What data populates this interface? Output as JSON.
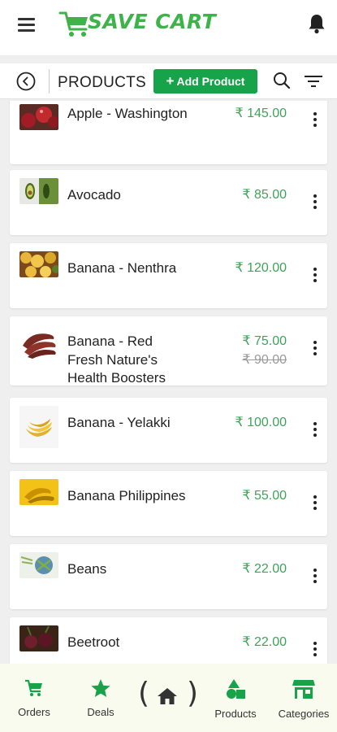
{
  "header": {
    "logo_text": "SAVE CART",
    "brand_color": "#3db34a"
  },
  "subbar": {
    "title": "PRODUCTS",
    "add_button_label": "Add Product",
    "accent_color": "#16a34a"
  },
  "products": [
    {
      "name": "Apple - Washington",
      "price": "₹ 145.00",
      "old_price": null,
      "thumb": "apple"
    },
    {
      "name": "Avocado",
      "price": "₹ 85.00",
      "old_price": null,
      "thumb": "avocado"
    },
    {
      "name": "Banana - Nenthra",
      "price": "₹ 120.00",
      "old_price": null,
      "thumb": "banana-chips"
    },
    {
      "name": "Banana - Red Fresh Nature's Health Boosters",
      "price": "₹ 75.00",
      "old_price": "₹ 90.00",
      "thumb": "red-banana"
    },
    {
      "name": "Banana - Yelakki",
      "price": "₹ 100.00",
      "old_price": null,
      "thumb": "yelakki"
    },
    {
      "name": "Banana Philippines",
      "price": "₹ 55.00",
      "old_price": null,
      "thumb": "banana-yellow"
    },
    {
      "name": "Beans",
      "price": "₹ 22.00",
      "old_price": null,
      "thumb": "beans"
    },
    {
      "name": "Beetroot",
      "price": "₹ 22.00",
      "old_price": null,
      "thumb": "beetroot"
    }
  ],
  "bottom_nav": {
    "orders": "Orders",
    "deals": "Deals",
    "products": "Products",
    "categories": "Categories",
    "icon_color": "#16a34a"
  }
}
